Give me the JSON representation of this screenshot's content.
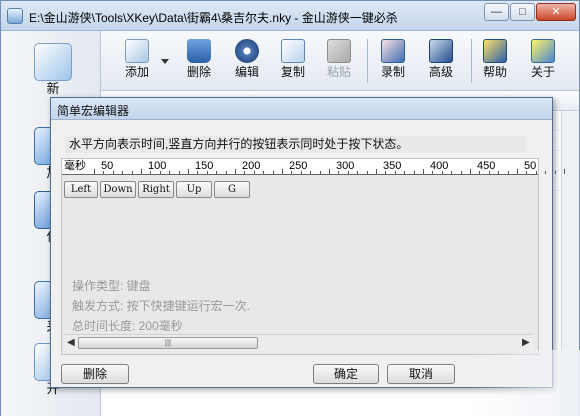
{
  "window": {
    "title": "E:\\金山游侠\\Tools\\XKey\\Data\\街霸4\\桑吉尔夫.nky - 金山游侠一键必杀",
    "minimize": "—",
    "maximize": "□",
    "close": "✕"
  },
  "toolbar": {
    "items": [
      {
        "label": "添加",
        "icon": "add-icon"
      },
      {
        "label": "删除",
        "icon": "trash-icon"
      },
      {
        "label": "编辑",
        "icon": "gear-icon"
      },
      {
        "label": "复制",
        "icon": "copy-icon"
      },
      {
        "label": "粘贴",
        "icon": "paste-icon",
        "disabled": true
      },
      {
        "label": "录制",
        "icon": "record-icon"
      },
      {
        "label": "高级",
        "icon": "hammer-icon"
      },
      {
        "label": "帮助",
        "icon": "book-icon"
      },
      {
        "label": "关于",
        "icon": "about-icon"
      }
    ]
  },
  "sidebar": {
    "items": [
      {
        "label": "新"
      },
      {
        "label": "加"
      },
      {
        "label": "保"
      },
      {
        "label": "采"
      },
      {
        "label": "开"
      }
    ]
  },
  "dialog": {
    "title": "简单宏编辑器",
    "hint": "水平方向表示时间,竖直方向并行的按钮表示同时处于按下状态。",
    "ruler": {
      "unit": "毫秒",
      "marks": [
        "50",
        "100",
        "150",
        "200",
        "250",
        "300",
        "350",
        "400",
        "450",
        "50"
      ]
    },
    "keys": [
      "Left",
      "Down",
      "Right",
      "Up",
      "G"
    ],
    "info": {
      "op_type": "操作类型: 键盘",
      "trigger": "触发方式: 按下快捷键运行宏一次.",
      "total_time": "总时间长度: 200毫秒"
    },
    "buttons": {
      "delete": "删除",
      "ok": "确定",
      "cancel": "取消"
    }
  },
  "colors": {
    "titlebar": "#c4d6ec",
    "dialog_bg": "#f0f0f0",
    "close_button": "#c9462b"
  }
}
